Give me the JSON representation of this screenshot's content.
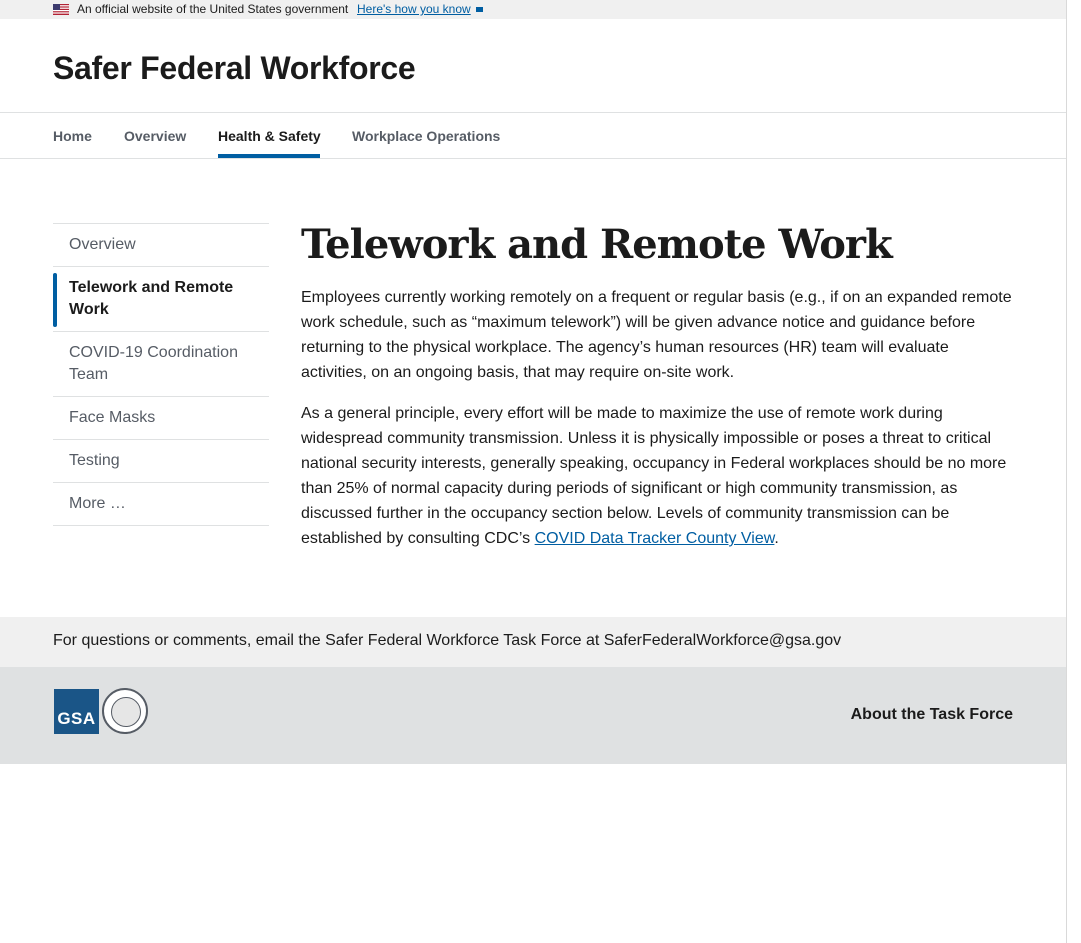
{
  "banner": {
    "text": "An official website of the United States government",
    "link": "Here's how you know"
  },
  "header": {
    "title": "Safer Federal Workforce"
  },
  "nav": {
    "items": [
      {
        "label": "Home"
      },
      {
        "label": "Overview"
      },
      {
        "label": "Health & Safety",
        "active": true
      },
      {
        "label": "Workplace Operations"
      }
    ]
  },
  "sidenav": {
    "items": [
      {
        "label": "Overview"
      },
      {
        "label": "Telework and Remote Work",
        "current": true
      },
      {
        "label": "COVID-19 Coordination Team"
      },
      {
        "label": "Face Masks"
      },
      {
        "label": "Testing"
      },
      {
        "label": "More …"
      }
    ]
  },
  "main": {
    "heading": "Telework and Remote Work",
    "paragraph1": "Employees currently working remotely on a frequent or regular basis (e.g., if on an expanded remote work schedule, such as “maximum telework”) will be given advance notice and guidance before returning to the physical workplace. The agency’s human resources (HR) team will evaluate activities, on an ongoing basis, that may require on-site work.",
    "paragraph2_before": "As a general principle, every effort will be made to maximize the use of remote work during widespread community transmission. Unless it is physically impossible or poses a threat to critical national security interests, generally speaking, occupancy in Federal workplaces should be no more than 25% of normal capacity during periods of significant or high community transmission, as discussed further in the occupancy section below. Levels of community transmission can be established by consulting CDC’s ",
    "paragraph2_link": "COVID Data Tracker County View",
    "paragraph2_after": "."
  },
  "footer": {
    "contact_text": "For questions or comments, email the Safer Federal Workforce Task Force at SaferFederalWorkforce@gsa.gov",
    "gsa_logo_text": "GSA",
    "about_link": "About the Task Force"
  },
  "colors": {
    "accent": "#005ea2",
    "banner_bg": "#f0f0f0",
    "footer_bottom_bg": "#dfe1e2",
    "gsa_blue": "#1a5587"
  }
}
